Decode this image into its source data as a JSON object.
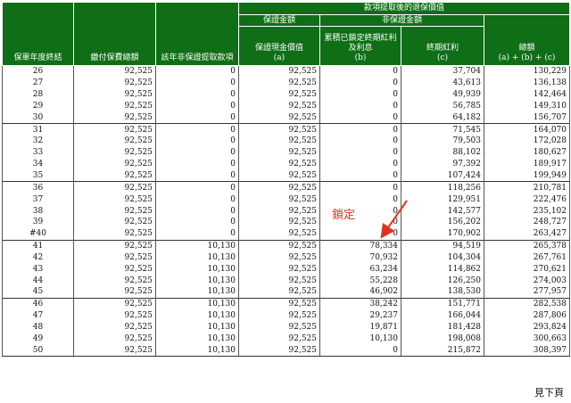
{
  "headers": {
    "policy_year": "保單年度終結",
    "premium_paid": "繳付保費總額",
    "non_guaranteed_withdrawal": "該年非保證提取款項",
    "after_withdrawal": "款項提取後的退保價值",
    "guaranteed_amount": "保證金額",
    "guaranteed_cash_value": "保證現金價值",
    "guaranteed_cash_value_sub": "(a)",
    "non_guaranteed_amount": "非保證金額",
    "accumulated_locked": "累積已鎖定終期紅利及利息",
    "accumulated_locked_sub": "(b)",
    "terminal_bonus": "終期紅利",
    "terminal_bonus_sub": "(c)",
    "total": "總額",
    "total_sub": "(a) + (b) + (c)"
  },
  "rows": [
    {
      "year": "26",
      "premium": "92,525",
      "withdrawal": "0",
      "gcv": "92,525",
      "locked": "0",
      "bonus": "37,704",
      "total": "130,229"
    },
    {
      "year": "27",
      "premium": "92,525",
      "withdrawal": "0",
      "gcv": "92,525",
      "locked": "0",
      "bonus": "43,613",
      "total": "136,138"
    },
    {
      "year": "28",
      "premium": "92,525",
      "withdrawal": "0",
      "gcv": "92,525",
      "locked": "0",
      "bonus": "49,939",
      "total": "142,464"
    },
    {
      "year": "29",
      "premium": "92,525",
      "withdrawal": "0",
      "gcv": "92,525",
      "locked": "0",
      "bonus": "56,785",
      "total": "149,310"
    },
    {
      "year": "30",
      "premium": "92,525",
      "withdrawal": "0",
      "gcv": "92,525",
      "locked": "0",
      "bonus": "64,182",
      "total": "156,707"
    },
    {
      "year": "31",
      "premium": "92,525",
      "withdrawal": "0",
      "gcv": "92,525",
      "locked": "0",
      "bonus": "71,545",
      "total": "164,070"
    },
    {
      "year": "32",
      "premium": "92,525",
      "withdrawal": "0",
      "gcv": "92,525",
      "locked": "0",
      "bonus": "79,503",
      "total": "172,028"
    },
    {
      "year": "33",
      "premium": "92,525",
      "withdrawal": "0",
      "gcv": "92,525",
      "locked": "0",
      "bonus": "88,102",
      "total": "180,627"
    },
    {
      "year": "34",
      "premium": "92,525",
      "withdrawal": "0",
      "gcv": "92,525",
      "locked": "0",
      "bonus": "97,392",
      "total": "189,917"
    },
    {
      "year": "35",
      "premium": "92,525",
      "withdrawal": "0",
      "gcv": "92,525",
      "locked": "0",
      "bonus": "107,424",
      "total": "199,949"
    },
    {
      "year": "36",
      "premium": "92,525",
      "withdrawal": "0",
      "gcv": "92,525",
      "locked": "0",
      "bonus": "118,256",
      "total": "210,781"
    },
    {
      "year": "37",
      "premium": "92,525",
      "withdrawal": "0",
      "gcv": "92,525",
      "locked": "0",
      "bonus": "129,951",
      "total": "222,476"
    },
    {
      "year": "38",
      "premium": "92,525",
      "withdrawal": "0",
      "gcv": "92,525",
      "locked": "0",
      "bonus": "142,577",
      "total": "235,102"
    },
    {
      "year": "39",
      "premium": "92,525",
      "withdrawal": "0",
      "gcv": "92,525",
      "locked": "0",
      "bonus": "156,202",
      "total": "248,727"
    },
    {
      "year": "#40",
      "premium": "92,525",
      "withdrawal": "0",
      "gcv": "92,525",
      "locked": "0",
      "bonus": "170,902",
      "total": "263,427"
    },
    {
      "year": "41",
      "premium": "92,525",
      "withdrawal": "10,130",
      "gcv": "92,525",
      "locked": "78,334",
      "bonus": "94,519",
      "total": "265,378"
    },
    {
      "year": "42",
      "premium": "92,525",
      "withdrawal": "10,130",
      "gcv": "92,525",
      "locked": "70,932",
      "bonus": "104,304",
      "total": "267,761"
    },
    {
      "year": "43",
      "premium": "92,525",
      "withdrawal": "10,130",
      "gcv": "92,525",
      "locked": "63,234",
      "bonus": "114,862",
      "total": "270,621"
    },
    {
      "year": "44",
      "premium": "92,525",
      "withdrawal": "10,130",
      "gcv": "92,525",
      "locked": "55,228",
      "bonus": "126,250",
      "total": "274,003"
    },
    {
      "year": "45",
      "premium": "92,525",
      "withdrawal": "10,130",
      "gcv": "92,525",
      "locked": "46,902",
      "bonus": "138,530",
      "total": "277,957"
    },
    {
      "year": "46",
      "premium": "92,525",
      "withdrawal": "10,130",
      "gcv": "92,525",
      "locked": "38,242",
      "bonus": "151,771",
      "total": "282,538"
    },
    {
      "year": "47",
      "premium": "92,525",
      "withdrawal": "10,130",
      "gcv": "92,525",
      "locked": "29,237",
      "bonus": "166,044",
      "total": "287,806"
    },
    {
      "year": "48",
      "premium": "92,525",
      "withdrawal": "10,130",
      "gcv": "92,525",
      "locked": "19,871",
      "bonus": "181,428",
      "total": "293,824"
    },
    {
      "year": "49",
      "premium": "92,525",
      "withdrawal": "10,130",
      "gcv": "92,525",
      "locked": "10,130",
      "bonus": "198,008",
      "total": "300,663"
    },
    {
      "year": "50",
      "premium": "92,525",
      "withdrawal": "10,130",
      "gcv": "92,525",
      "locked": "0",
      "bonus": "215,872",
      "total": "308,397"
    }
  ],
  "annotation": {
    "text": "鎖定",
    "color": "#e0321e"
  },
  "footer": {
    "next_page": "見下頁"
  },
  "colors": {
    "header_bg": "#0f6e16",
    "header_text": "#ffffff"
  }
}
